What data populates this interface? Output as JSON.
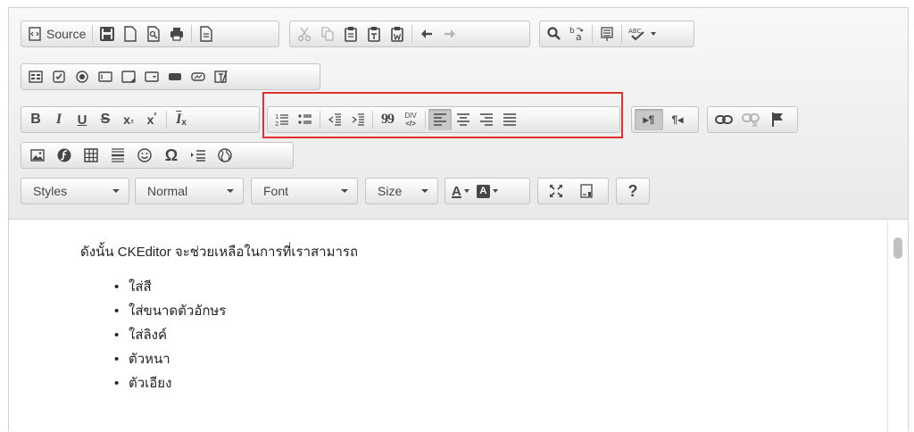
{
  "toolbar": {
    "source_label": "Source",
    "styles_label": "Styles",
    "format_label": "Normal",
    "font_label": "Font",
    "size_label": "Size",
    "text_color_label": "A",
    "bg_color_label": "A",
    "help_label": "?",
    "bold_label": "B",
    "italic_label": "I",
    "underline_label": "U",
    "strike_label": "S",
    "subscript_label": "x",
    "subscript_sub": "₂",
    "superscript_label": "x",
    "superscript_sup": "²",
    "remove_format_label": "I",
    "remove_format_sub": "x",
    "omega_label": "Ω",
    "blockquote_label": "99",
    "div_label_top": "DIV",
    "div_label_bottom": "</>",
    "abc_label": "ABC",
    "ltr_label": "▸¶",
    "rtl_label": "¶◂"
  },
  "content": {
    "paragraph": "ดังนั้น CKEditor จะช่วยเหลือในการที่เราสามารถ",
    "list": [
      "ใส่สี",
      "ใส่ขนาดตัวอักษร",
      "ใส่ลิงค์",
      "ตัวหนา",
      "ตัวเอียง"
    ]
  },
  "colors": {
    "highlight": "#e0312d",
    "icon": "#474747",
    "toolbar_bg": "#eeeeee"
  }
}
